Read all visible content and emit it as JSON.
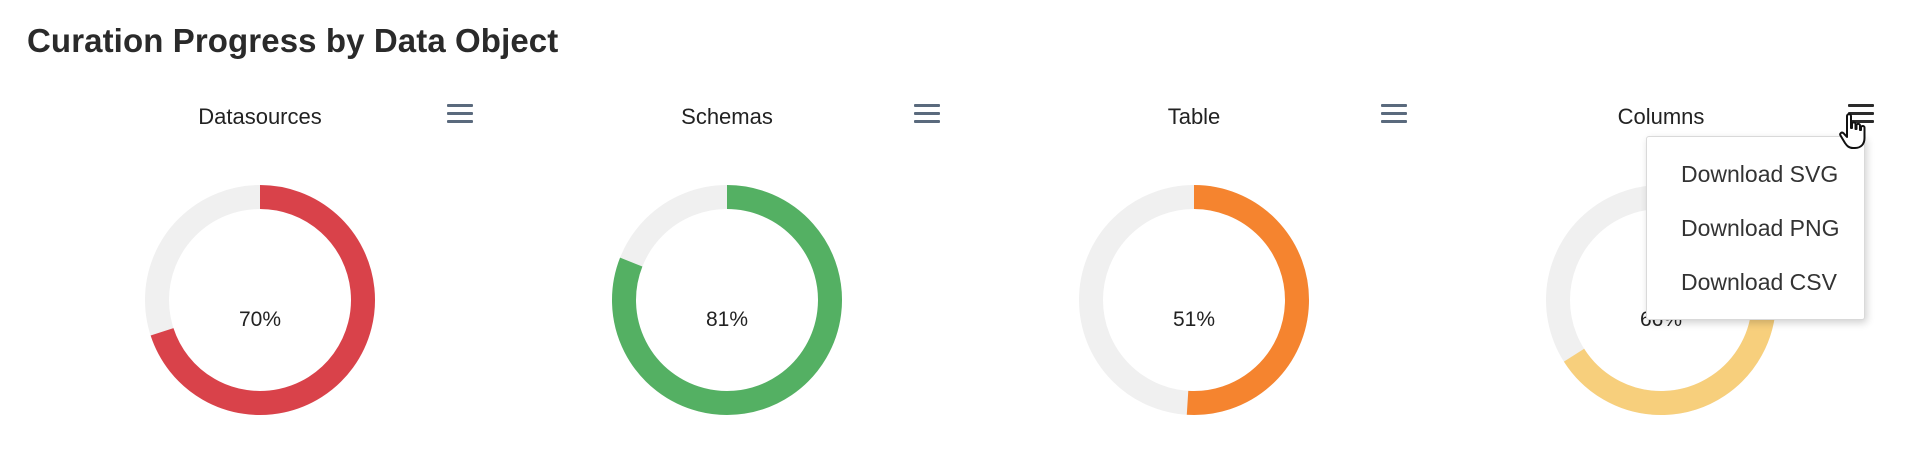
{
  "page": {
    "title": "Curation Progress by Data Object"
  },
  "colors": {
    "track": "#f0f0f0",
    "red": "#d9424a",
    "green": "#54b063",
    "orange": "#f5842f",
    "yellow": "#f7cf7c"
  },
  "icons": {
    "menu": "hamburger-menu-icon",
    "cursor": "hand-pointer-cursor-icon"
  },
  "chart_data": [
    {
      "type": "pie",
      "style": "donut",
      "title": "Datasources",
      "value": 70,
      "label": "70%",
      "color": "#d9424a"
    },
    {
      "type": "pie",
      "style": "donut",
      "title": "Schemas",
      "value": 81,
      "label": "81%",
      "color": "#54b063"
    },
    {
      "type": "pie",
      "style": "donut",
      "title": "Table",
      "value": 51,
      "label": "51%",
      "color": "#f5842f"
    },
    {
      "type": "pie",
      "style": "donut",
      "title": "Columns",
      "value": 66,
      "label": "66%",
      "color": "#f7cf7c"
    }
  ],
  "export_menu": {
    "items": [
      "Download SVG",
      "Download PNG",
      "Download CSV"
    ]
  }
}
